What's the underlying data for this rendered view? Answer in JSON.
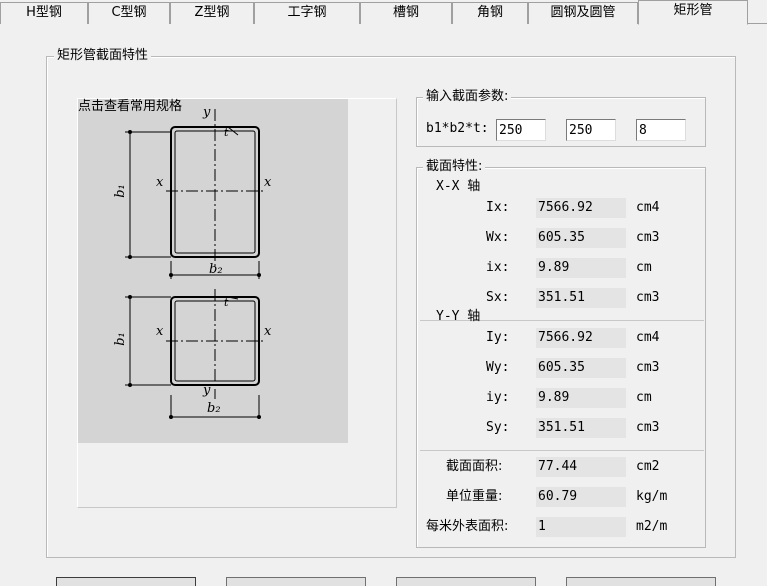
{
  "tabs": [
    "H型钢",
    "C型钢",
    "Z型钢",
    "工字钢",
    "槽钢",
    "角钢",
    "圆钢及圆管",
    "矩形管"
  ],
  "active_tab": "矩形管",
  "main_group": {
    "title": "矩形管截面特性"
  },
  "canvas": {
    "link_text": "点击查看常用规格",
    "top": {
      "y_top": "y",
      "t": "t",
      "b1": "b₁",
      "x_left": "x",
      "x_right": "x",
      "b2": "b₂"
    },
    "bottom": {
      "t": "t",
      "b1": "b₁",
      "x_left": "x",
      "x_right": "x",
      "y_bottom": "y",
      "b2": "b₂"
    }
  },
  "input_group": {
    "title": "输入截面参数:",
    "label": "b1*b2*t:",
    "b1": "250",
    "b2": "250",
    "t": "8"
  },
  "props_group": {
    "title": "截面特性:",
    "xx_heading": "X-X 轴",
    "yy_heading": "Y-Y 轴",
    "rows": [
      {
        "label": "Ix:",
        "value": "7566.92",
        "unit": "cm4"
      },
      {
        "label": "Wx:",
        "value": "605.35",
        "unit": "cm3"
      },
      {
        "label": "ix:",
        "value": "9.89",
        "unit": "cm"
      },
      {
        "label": "Sx:",
        "value": "351.51",
        "unit": "cm3"
      },
      {
        "label": "Iy:",
        "value": "7566.92",
        "unit": "cm4"
      },
      {
        "label": "Wy:",
        "value": "605.35",
        "unit": "cm3"
      },
      {
        "label": "iy:",
        "value": "9.89",
        "unit": "cm"
      },
      {
        "label": "Sy:",
        "value": "351.51",
        "unit": "cm3"
      }
    ],
    "area": {
      "label": "截面面积:",
      "value": "77.44",
      "unit": "cm2"
    },
    "weight": {
      "label": "单位重量:",
      "value": "60.79",
      "unit": "kg/m"
    },
    "surface": {
      "label": "每米外表面积:",
      "value": "1",
      "unit": "m2/m"
    }
  }
}
